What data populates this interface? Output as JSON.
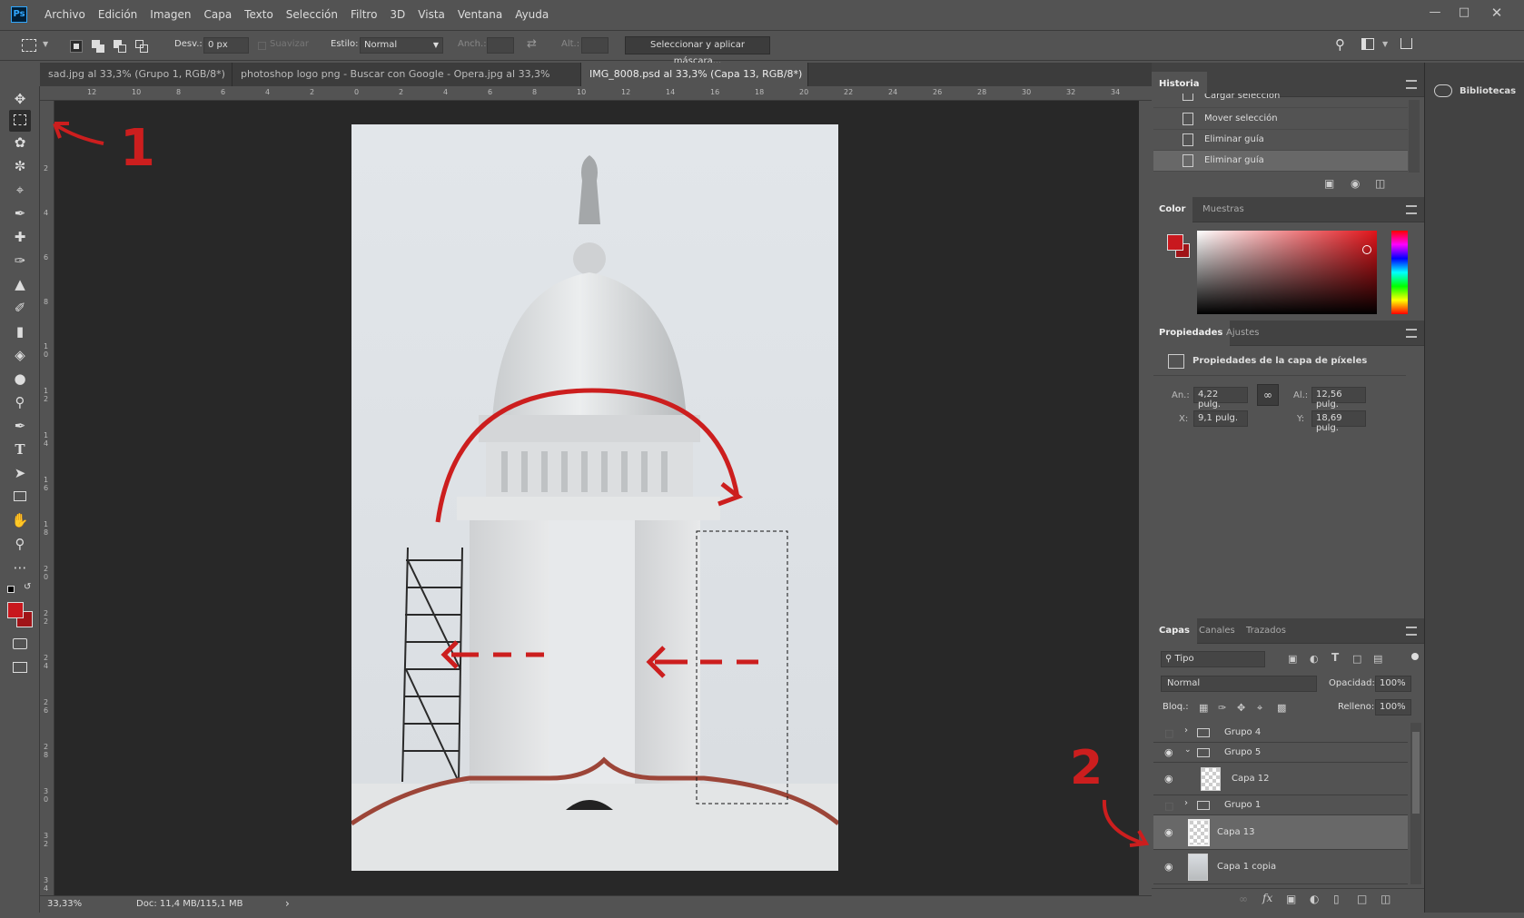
{
  "app": {
    "logo": "Ps"
  },
  "menu": [
    "Archivo",
    "Edición",
    "Imagen",
    "Capa",
    "Texto",
    "Selección",
    "Filtro",
    "3D",
    "Vista",
    "Ventana",
    "Ayuda"
  ],
  "options": {
    "desv_label": "Desv.:",
    "desv_value": "0 px",
    "suavizar_label": "Suavizar",
    "estilo_label": "Estilo:",
    "estilo_value": "Normal",
    "anch_label": "Anch.:",
    "alt_label": "Alt.:",
    "select_mask_button": "Seleccionar y aplicar máscara..."
  },
  "tabs": [
    {
      "label": "sad.jpg al 33,3% (Grupo 1, RGB/8*) *",
      "close": "×"
    },
    {
      "label": "photoshop logo png - Buscar con Google - Opera.jpg al 33,3% (RGB/8#)",
      "close": "×"
    },
    {
      "label": "IMG_8008.psd al 33,3% (Capa 13, RGB/8*) *",
      "close": "×"
    }
  ],
  "ruler_top": [
    "12",
    "10",
    "8",
    "6",
    "4",
    "2",
    "0",
    "2",
    "4",
    "6",
    "8",
    "10",
    "12",
    "14",
    "16",
    "18",
    "20",
    "22",
    "24",
    "26",
    "28",
    "30",
    "32",
    "34"
  ],
  "ruler_left": [
    "2",
    "4",
    "6",
    "8",
    "1\n0",
    "1\n2",
    "1\n4",
    "1\n6",
    "1\n8",
    "2\n0",
    "2\n2",
    "2\n4",
    "2\n6",
    "2\n8",
    "3\n0",
    "3\n2",
    "3\n4"
  ],
  "annotations": {
    "one": "1",
    "two": "2"
  },
  "status": {
    "zoom": "33,33%",
    "doc": "Doc: 11,4 MB/115,1 MB",
    "arrow": "›"
  },
  "history": {
    "title": "Historia",
    "items": [
      "Cargar selección",
      "Mover selección",
      "Eliminar guía",
      "Eliminar guía"
    ]
  },
  "color": {
    "tabs": [
      "Color",
      "Muestras"
    ],
    "foreground": "#c8181e",
    "background": "#a01418"
  },
  "properties": {
    "tabs": [
      "Propiedades",
      "Ajustes"
    ],
    "heading": "Propiedades de la capa de píxeles",
    "an_label": "An.:",
    "an_value": "4,22 pulg.",
    "al_label": "Al.:",
    "al_value": "12,56 pulg.",
    "x_label": "X:",
    "x_value": "9,1 pulg.",
    "y_label": "Y:",
    "y_value": "18,69 pulg."
  },
  "layers": {
    "tabs": [
      "Capas",
      "Canales",
      "Trazados"
    ],
    "filter_value": "Tipo",
    "blend_mode": "Normal",
    "opacity_label": "Opacidad:",
    "opacity_value": "100%",
    "lock_label": "Bloq.:",
    "fill_label": "Relleno:",
    "fill_value": "100%",
    "items": [
      {
        "name": "Grupo 4",
        "visible": false,
        "type": "group"
      },
      {
        "name": "Grupo 5",
        "visible": true,
        "type": "group"
      },
      {
        "name": "Capa 12",
        "visible": true,
        "type": "layer"
      },
      {
        "name": "Grupo 1",
        "visible": false,
        "type": "group"
      },
      {
        "name": "Capa 13",
        "visible": true,
        "type": "layer",
        "selected": true
      },
      {
        "name": "Capa 1 copia",
        "visible": true,
        "type": "layer"
      }
    ]
  },
  "libraries": {
    "label": "Bibliotecas"
  },
  "icons": [
    "move-icon",
    "marquee-icon",
    "lasso-icon",
    "quick-select-icon",
    "crop-icon",
    "eyedropper-icon",
    "healing-icon",
    "brush-icon",
    "stamp-icon",
    "history-brush-icon",
    "eraser-icon",
    "bucket-icon",
    "blur-icon",
    "dodge-icon",
    "pen-icon",
    "type-icon",
    "path-select-icon",
    "rectangle-icon",
    "hand-icon",
    "zoom-icon",
    "more-icon"
  ]
}
